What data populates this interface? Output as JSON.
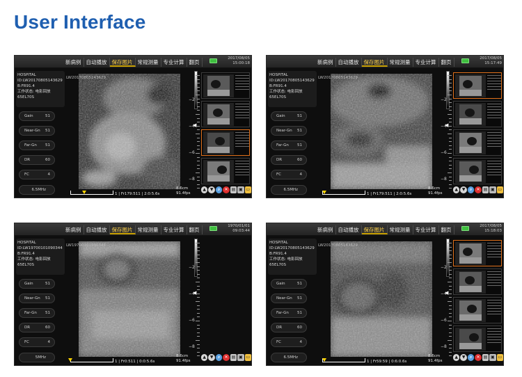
{
  "page_title": "User Interface",
  "screens": [
    {
      "menu": [
        "新病例",
        "自动播放",
        "保存图片",
        "常规测量",
        "专业计算",
        "翻页"
      ],
      "active_menu": 2,
      "date": "2017/08/05",
      "time": "15:00:18",
      "patient": [
        "HOSPITAL",
        "ID:LW20170805143629",
        "B:FR91.4",
        "工作状态: 电影回放",
        "65EL70S"
      ],
      "image_id": "LW20170805143629",
      "params": [
        {
          "label": "Gain",
          "value": "51"
        },
        {
          "label": "Near-Gn",
          "value": "51"
        },
        {
          "label": "Far-Gn",
          "value": "51"
        },
        {
          "label": "DR",
          "value": "60"
        },
        {
          "label": "FC",
          "value": "4"
        },
        {
          "label": "",
          "value": "6.5MHz"
        }
      ],
      "depth_labels": [
        "2",
        "4",
        "6",
        "8"
      ],
      "depth": "8.6cm",
      "fps": "91.4fps",
      "cine_text": "1 | Fr179:511 | 2:0:5.6s",
      "cine_marker_pct": 0.32,
      "selected_thumb": 2
    },
    {
      "menu": [
        "新病例",
        "自动播放",
        "保存图片",
        "常规测量",
        "专业计算",
        "翻页"
      ],
      "active_menu": 2,
      "date": "2017/08/05",
      "time": "15:17:49",
      "patient": [
        "HOSPITAL",
        "ID:LW20170805143629",
        "B:FR91.4",
        "工作状态: 电影回放",
        "65EL70S"
      ],
      "image_id": "LW20170805143629",
      "params": [
        {
          "label": "Gain",
          "value": "51"
        },
        {
          "label": "Near-Gn",
          "value": "51"
        },
        {
          "label": "Far-Gn",
          "value": "51"
        },
        {
          "label": "DR",
          "value": "60"
        },
        {
          "label": "FC",
          "value": "4"
        },
        {
          "label": "",
          "value": "6.5MHz"
        }
      ],
      "depth_labels": [
        "2",
        "4",
        "6",
        "8"
      ],
      "depth": "8.6cm",
      "fps": "91.4fps",
      "cine_text": "1 | Fr179:511 | 2:0:5.6s",
      "cine_marker_pct": 0.05,
      "selected_thumb": 0
    },
    {
      "menu": [
        "新病例",
        "自动播放",
        "保存图片",
        "常规测量",
        "专业计算",
        "翻页"
      ],
      "active_menu": 2,
      "date": "1970/01/01",
      "time": "09:03:44",
      "patient": [
        "HOSPITAL",
        "ID:LW19700101090344",
        "B:FR91.4",
        "工作状态: 电影回放",
        "65EL70S"
      ],
      "image_id": "LW19700101090344",
      "params": [
        {
          "label": "Gain",
          "value": "51"
        },
        {
          "label": "Near-Gn",
          "value": "51"
        },
        {
          "label": "Far-Gn",
          "value": "51"
        },
        {
          "label": "DR",
          "value": "60"
        },
        {
          "label": "FC",
          "value": "4"
        },
        {
          "label": "",
          "value": "5MHz"
        }
      ],
      "depth_labels": [
        "2",
        "4",
        "6",
        "8"
      ],
      "depth": "8.6cm",
      "fps": "91.4fps",
      "cine_text": "1 | Fr0:511 | 0:0:5.6s",
      "cine_marker_pct": 0.0,
      "selected_thumb": -1
    },
    {
      "menu": [
        "新病例",
        "自动播放",
        "保存图片",
        "常规测量",
        "专业计算",
        "翻页"
      ],
      "active_menu": 2,
      "date": "2017/08/05",
      "time": "15:18:03",
      "patient": [
        "HOSPITAL",
        "ID:LW20170805143629",
        "B:FR91.4",
        "工作状态: 电影回放",
        "65EL70S"
      ],
      "image_id": "LW20170805143629",
      "params": [
        {
          "label": "Gain",
          "value": "51"
        },
        {
          "label": "Near-Gn",
          "value": "51"
        },
        {
          "label": "Far-Gn",
          "value": "51"
        },
        {
          "label": "DR",
          "value": "60"
        },
        {
          "label": "FC",
          "value": "4"
        },
        {
          "label": "",
          "value": "6.5MHz"
        }
      ],
      "depth_labels": [
        "2",
        "4",
        "6",
        "8"
      ],
      "depth": "8.6cm",
      "fps": "91.4fps",
      "cine_text": "1 | Fr59:59 | 0:6:0.6s",
      "cine_marker_pct": 0.05,
      "selected_thumb": 0
    }
  ],
  "colors": {
    "title": "#1f5fb0",
    "active_menu": "#ffd24a",
    "selection": "#e0701a",
    "battery": "#3fbf3f"
  },
  "icons": [
    "arrow-up-icon",
    "arrow-down-icon",
    "search-icon",
    "delete-icon",
    "print-icon",
    "lock-icon",
    "folder-icon"
  ]
}
